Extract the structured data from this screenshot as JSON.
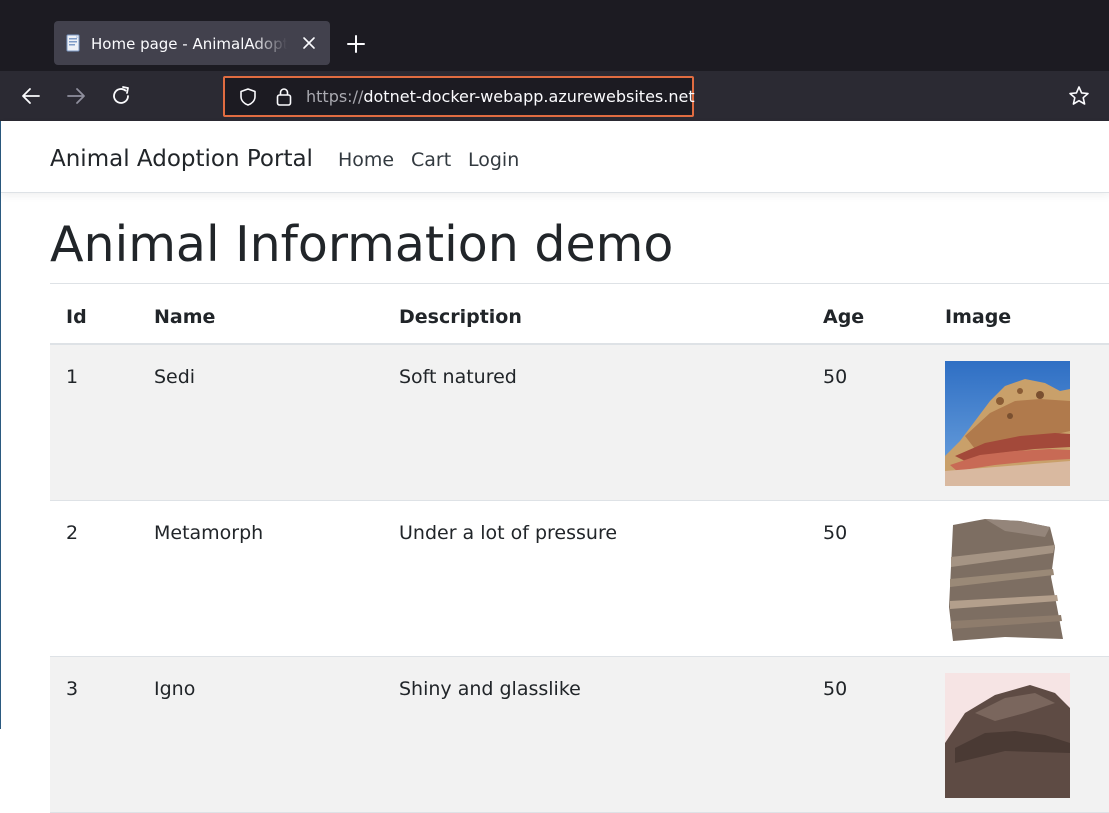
{
  "browser": {
    "tab_title": "Home page - AnimalAdoption",
    "url_scheme": "https://",
    "url_host": "dotnet-docker-webapp.azurewebsites.net",
    "url_highlight_color": "#e06c41"
  },
  "site": {
    "brand": "Animal Adoption Portal",
    "nav": [
      "Home",
      "Cart",
      "Login"
    ]
  },
  "main": {
    "heading": "Animal Information demo",
    "table": {
      "headers": [
        "Id",
        "Name",
        "Description",
        "Age",
        "Image"
      ],
      "rows": [
        {
          "id": "1",
          "name": "Sedi",
          "description": "Soft natured",
          "age": "50",
          "image": "sedimentary-rock-photo"
        },
        {
          "id": "2",
          "name": "Metamorph",
          "description": "Under a lot of pressure",
          "age": "50",
          "image": "metamorphic-rock-photo"
        },
        {
          "id": "3",
          "name": "Igno",
          "description": "Shiny and glasslike",
          "age": "50",
          "image": "igneous-rock-photo"
        }
      ]
    }
  }
}
